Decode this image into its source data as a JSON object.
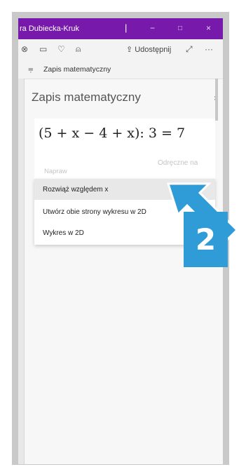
{
  "titlebar": {
    "user": "ra Dubiecka-Kruk",
    "sep": "|",
    "minimize": "−",
    "maximize": "□",
    "close": "×"
  },
  "toolbar": {
    "share_label": "Udostępnij",
    "more": "···"
  },
  "ribbon": {
    "label": "Zapis matematyczny"
  },
  "panel": {
    "title": "Zapis matematyczny",
    "close": "×",
    "equation": "(5 + x − 4 + x): 3 = 7",
    "ghost_left": "Napraw",
    "ghost_right": "Odręczne na"
  },
  "menu": {
    "items": [
      "Rozwiąż względem x",
      "Utwórz obie strony wykresu w 2D",
      "Wykres w 2D"
    ]
  },
  "callout": {
    "number": "2",
    "color": "#2f9bd7"
  },
  "colors": {
    "title_bar": "#7719aa",
    "arrow": "#2f9bd7"
  }
}
